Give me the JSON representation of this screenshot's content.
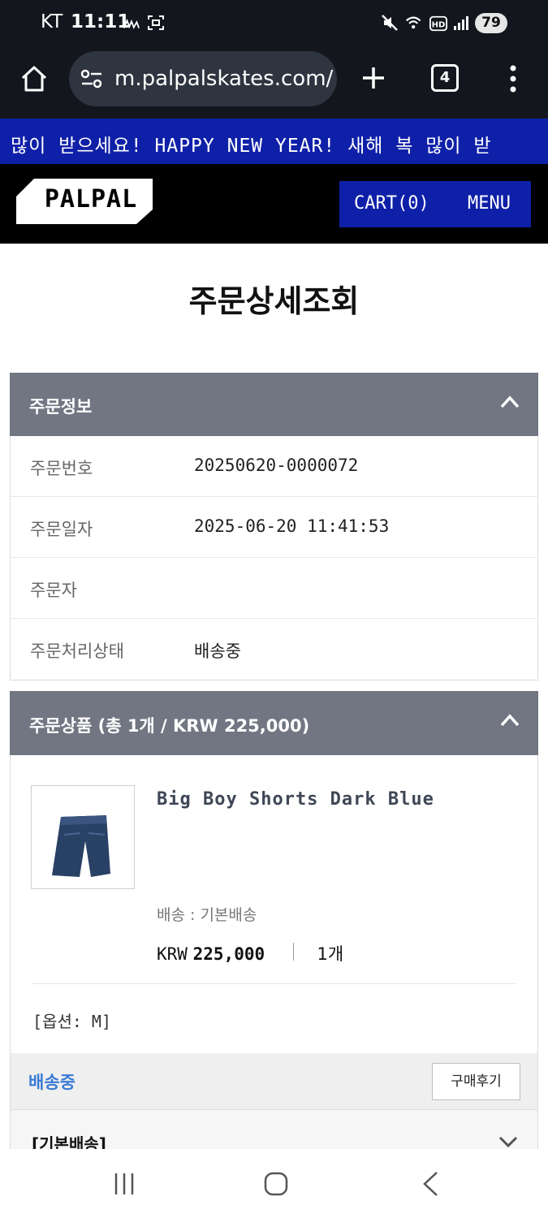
{
  "status_bar": {
    "carrier": "KT",
    "time": "11:11",
    "battery": "79"
  },
  "browser": {
    "url": "m.palpalskates.com/",
    "tab_count": "4"
  },
  "marquee": {
    "text": "복 많이 받으세요! HAPPY NEW YEAR! 새해 복 많이 받"
  },
  "site_header": {
    "logo": "PALPAL",
    "cart_label": "CART(0)",
    "menu_label": "MENU"
  },
  "page": {
    "title": "주문상세조회"
  },
  "order_info": {
    "section_title": "주문정보",
    "rows": [
      {
        "label": "주문번호",
        "value": "20250620-0000072"
      },
      {
        "label": "주문일자",
        "value": "2025-06-20 11:41:53"
      },
      {
        "label": "주문자",
        "value": ""
      },
      {
        "label": "주문처리상태",
        "value": "배송중"
      }
    ]
  },
  "order_items": {
    "section_title": "주문상품 (총 1개 / KRW 225,000)",
    "product": {
      "name": "Big Boy Shorts Dark Blue",
      "shipping": "배송 : 기본배송",
      "currency": "KRW",
      "price": "225,000",
      "quantity": "1개",
      "option": "[옵션: M]"
    },
    "status": "배송중",
    "review_button": "구매후기",
    "shipping_group": "[기본배송]"
  },
  "colors": {
    "brand_blue": "#0f20a8",
    "panel_header": "#717682",
    "status_blue": "#3a7bd5"
  }
}
